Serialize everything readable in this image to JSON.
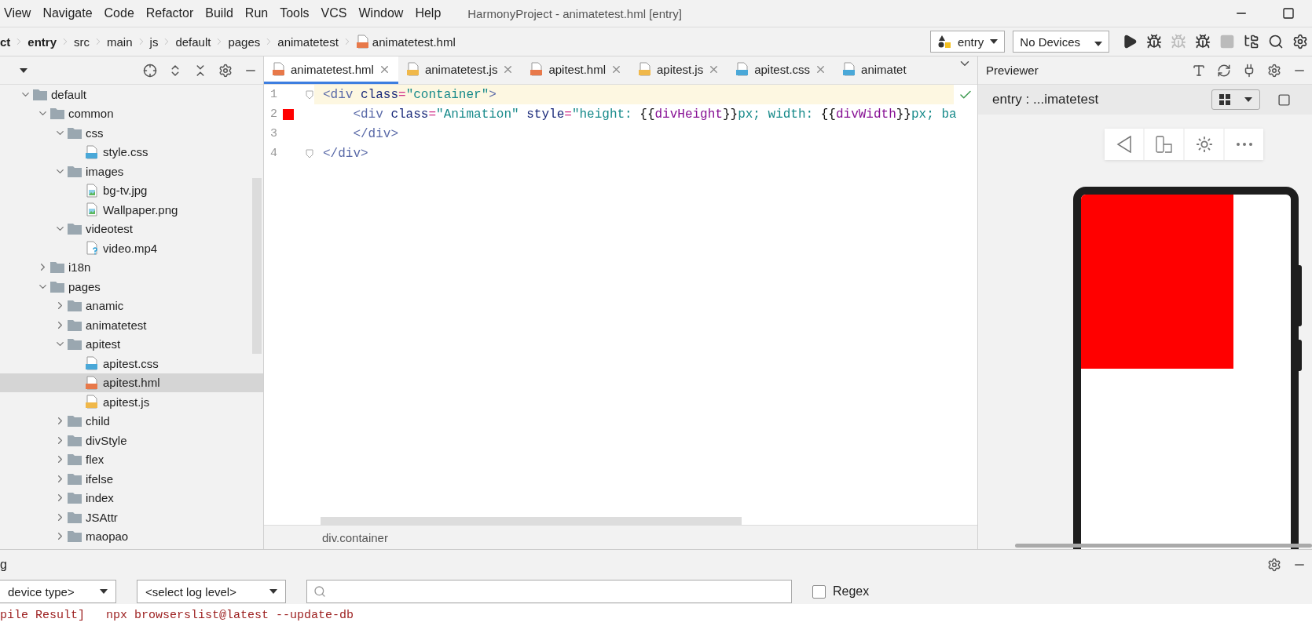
{
  "window": {
    "title": "HarmonyProject - animatetest.hml [entry]"
  },
  "menu": [
    "View",
    "Navigate",
    "Code",
    "Refactor",
    "Build",
    "Run",
    "Tools",
    "VCS",
    "Window",
    "Help"
  ],
  "breadcrumb": [
    {
      "label": "ct",
      "bold": true,
      "kind": "dir"
    },
    {
      "label": "entry",
      "bold": true,
      "kind": "dir"
    },
    {
      "label": "src",
      "bold": false,
      "kind": "dir"
    },
    {
      "label": "main",
      "bold": false,
      "kind": "dir"
    },
    {
      "label": "js",
      "bold": false,
      "kind": "dir"
    },
    {
      "label": "default",
      "bold": false,
      "kind": "dir"
    },
    {
      "label": "pages",
      "bold": false,
      "kind": "dir"
    },
    {
      "label": "animatetest",
      "bold": false,
      "kind": "dir"
    },
    {
      "label": "animatetest.hml",
      "bold": false,
      "kind": "hml"
    }
  ],
  "run_config": {
    "module": "entry",
    "device": "No Devices"
  },
  "toolbar": [
    {
      "kind": "run",
      "disabled": false
    },
    {
      "kind": "debug",
      "disabled": false
    },
    {
      "kind": "attach",
      "disabled": true
    },
    {
      "kind": "profile",
      "disabled": false
    },
    {
      "kind": "stop",
      "disabled": true
    },
    {
      "kind": "structure",
      "disabled": false
    },
    {
      "kind": "search",
      "disabled": false
    },
    {
      "kind": "settings",
      "disabled": false
    }
  ],
  "project_tree": [
    {
      "label": "default",
      "kind": "folder",
      "expanded": true,
      "selected": false,
      "children": [
        {
          "label": "common",
          "kind": "folder",
          "expanded": true,
          "selected": false,
          "children": [
            {
              "label": "css",
              "kind": "folder",
              "expanded": true,
              "selected": false,
              "children": [
                {
                  "label": "style.css",
                  "kind": "css",
                  "selected": false
                }
              ]
            },
            {
              "label": "images",
              "kind": "folder",
              "expanded": true,
              "selected": false,
              "children": [
                {
                  "label": "bg-tv.jpg",
                  "kind": "image",
                  "selected": false
                },
                {
                  "label": "Wallpaper.png",
                  "kind": "image",
                  "selected": false
                }
              ]
            },
            {
              "label": "videotest",
              "kind": "folder",
              "expanded": true,
              "selected": false,
              "children": [
                {
                  "label": "video.mp4",
                  "kind": "unknown",
                  "selected": false
                }
              ]
            }
          ]
        },
        {
          "label": "i18n",
          "kind": "folder",
          "expanded": false,
          "selected": false
        },
        {
          "label": "pages",
          "kind": "folder",
          "expanded": true,
          "selected": false,
          "children": [
            {
              "label": "anamic",
              "kind": "folder",
              "expanded": false,
              "selected": false
            },
            {
              "label": "animatetest",
              "kind": "folder",
              "expanded": false,
              "selected": false
            },
            {
              "label": "apitest",
              "kind": "folder",
              "expanded": true,
              "selected": false,
              "children": [
                {
                  "label": "apitest.css",
                  "kind": "css",
                  "selected": false
                },
                {
                  "label": "apitest.hml",
                  "kind": "hml",
                  "selected": true
                },
                {
                  "label": "apitest.js",
                  "kind": "js",
                  "selected": false
                }
              ]
            },
            {
              "label": "child",
              "kind": "folder",
              "expanded": false,
              "selected": false
            },
            {
              "label": "divStyle",
              "kind": "folder",
              "expanded": false,
              "selected": false
            },
            {
              "label": "flex",
              "kind": "folder",
              "expanded": false,
              "selected": false
            },
            {
              "label": "ifelse",
              "kind": "folder",
              "expanded": false,
              "selected": false
            },
            {
              "label": "index",
              "kind": "folder",
              "expanded": false,
              "selected": false
            },
            {
              "label": "JSAttr",
              "kind": "folder",
              "expanded": false,
              "selected": false
            },
            {
              "label": "maopao",
              "kind": "folder",
              "expanded": false,
              "selected": false
            }
          ]
        }
      ]
    }
  ],
  "editor": {
    "tabs": [
      {
        "label": "animatetest.hml",
        "kind": "hml",
        "selected": true
      },
      {
        "label": "animatetest.js",
        "kind": "js",
        "selected": false
      },
      {
        "label": "apitest.hml",
        "kind": "hml",
        "selected": false
      },
      {
        "label": "apitest.js",
        "kind": "js",
        "selected": false
      },
      {
        "label": "apitest.css",
        "kind": "css",
        "selected": false
      },
      {
        "label": "animatet",
        "kind": "css",
        "selected": false
      }
    ],
    "lines": [
      {
        "number": "1",
        "current": true,
        "breakpoint": false,
        "fold": true,
        "tokens": [
          {
            "kind": "tag",
            "text": "<div"
          },
          {
            "kind": "attr",
            "text": " class"
          },
          {
            "kind": "eq",
            "text": "="
          },
          {
            "kind": "str",
            "text": "\"container\""
          },
          {
            "kind": "tag",
            "text": ">"
          }
        ]
      },
      {
        "number": "2",
        "current": false,
        "breakpoint": true,
        "fold": false,
        "tokens": [
          {
            "kind": "tag",
            "text": "    <div"
          },
          {
            "kind": "attr",
            "text": " class"
          },
          {
            "kind": "eq",
            "text": "="
          },
          {
            "kind": "str",
            "text": "\"Animation\""
          },
          {
            "kind": "attr",
            "text": " style"
          },
          {
            "kind": "eq",
            "text": "="
          },
          {
            "kind": "str",
            "text": "\"height: "
          },
          {
            "kind": "brace",
            "text": "{{"
          },
          {
            "kind": "var",
            "text": "divHeight"
          },
          {
            "kind": "brace",
            "text": "}}"
          },
          {
            "kind": "str",
            "text": "px; width: "
          },
          {
            "kind": "brace",
            "text": "{{"
          },
          {
            "kind": "var",
            "text": "divWidth"
          },
          {
            "kind": "brace",
            "text": "}}"
          },
          {
            "kind": "str",
            "text": "px; ba"
          }
        ]
      },
      {
        "number": "3",
        "current": false,
        "breakpoint": false,
        "fold": false,
        "tokens": [
          {
            "kind": "tag",
            "text": "    </div>"
          }
        ]
      },
      {
        "number": "4",
        "current": false,
        "breakpoint": false,
        "fold": true,
        "tokens": [
          {
            "kind": "tag",
            "text": "</div>"
          }
        ]
      }
    ],
    "status": "div.container"
  },
  "previewer": {
    "title": "Previewer",
    "target": "entry : ...imatetest"
  },
  "log": {
    "title": "g",
    "device_filter": "device type>",
    "level_filter": "<select log level>",
    "regex": {
      "label": "Regex",
      "checked": false
    },
    "lines": [
      {
        "source": "pile Result]",
        "message": "npx browserslist@latest --update-db"
      }
    ]
  }
}
